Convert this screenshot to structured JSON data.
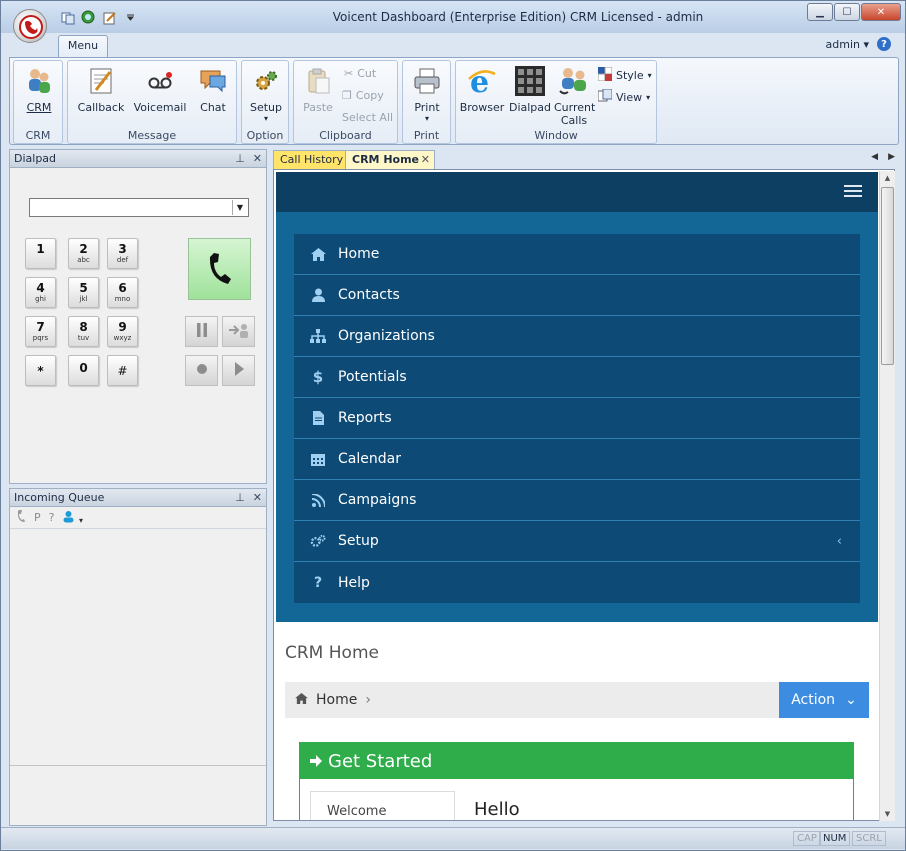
{
  "window": {
    "title": "Voicent Dashboard (Enterprise Edition) CRM Licensed - admin",
    "min": "▁",
    "max": "☐",
    "close": "✕"
  },
  "ribbon": {
    "menu_tab": "Menu",
    "user": "admin",
    "user_caret": "▾",
    "help": "?",
    "groups": {
      "crm": "CRM",
      "message": "Message",
      "option": "Option",
      "clipboard": "Clipboard",
      "print": "Print",
      "window": "Window"
    },
    "buttons": {
      "crm": "CRM",
      "callback": "Callback",
      "voicemail": "Voicemail",
      "chat": "Chat",
      "setup": "Setup",
      "paste": "Paste",
      "cut": "Cut",
      "copy": "Copy",
      "select_all": "Select All",
      "print": "Print",
      "browser": "Browser",
      "dialpad": "Dialpad",
      "current_calls": "Current Calls",
      "style": "Style",
      "view": "View"
    }
  },
  "dialpad": {
    "title": "Dialpad",
    "pin": "⊥",
    "close": "✕",
    "number_value": "",
    "keys": [
      {
        "digit": "1",
        "letters": ""
      },
      {
        "digit": "2",
        "letters": "abc"
      },
      {
        "digit": "3",
        "letters": "def"
      },
      {
        "digit": "4",
        "letters": "ghi"
      },
      {
        "digit": "5",
        "letters": "jkl"
      },
      {
        "digit": "6",
        "letters": "mno"
      },
      {
        "digit": "7",
        "letters": "pqrs"
      },
      {
        "digit": "8",
        "letters": "tuv"
      },
      {
        "digit": "9",
        "letters": "wxyz"
      },
      {
        "digit": "*",
        "letters": ""
      },
      {
        "digit": "0",
        "letters": ""
      },
      {
        "digit": "#",
        "letters": ""
      }
    ]
  },
  "queue": {
    "title": "Incoming Queue",
    "pin": "⊥",
    "close": "✕",
    "tool_p": "P",
    "tool_q": "?"
  },
  "tabs": {
    "call_history": "Call History",
    "crm_home": "CRM Home",
    "close": "✕",
    "prev": "◀",
    "next": "▶"
  },
  "crm": {
    "nav": [
      {
        "label": "Home",
        "icon": "home-icon"
      },
      {
        "label": "Contacts",
        "icon": "user-icon"
      },
      {
        "label": "Organizations",
        "icon": "sitemap-icon"
      },
      {
        "label": "Potentials",
        "icon": "dollar-icon"
      },
      {
        "label": "Reports",
        "icon": "file-icon"
      },
      {
        "label": "Calendar",
        "icon": "calendar-icon"
      },
      {
        "label": "Campaigns",
        "icon": "rss-icon"
      },
      {
        "label": "Setup",
        "icon": "gears-icon"
      },
      {
        "label": "Help",
        "icon": "question-icon"
      }
    ],
    "setup_chevron": "‹",
    "page_title": "CRM Home",
    "breadcrumb_home": "Home",
    "breadcrumb_sep": "›",
    "action": "Action",
    "action_caret": "⌄",
    "card_title": "Get Started",
    "card_tab": "Welcome",
    "hello": "Hello"
  },
  "status": {
    "cap": "CAP",
    "num": "NUM",
    "scrl": "SCRL"
  },
  "colors": {
    "nav_bg": "#0d4b76",
    "nav_frame": "#136797",
    "topbar": "#0d3f63",
    "action": "#3c8de2",
    "card": "#2fad4a"
  }
}
